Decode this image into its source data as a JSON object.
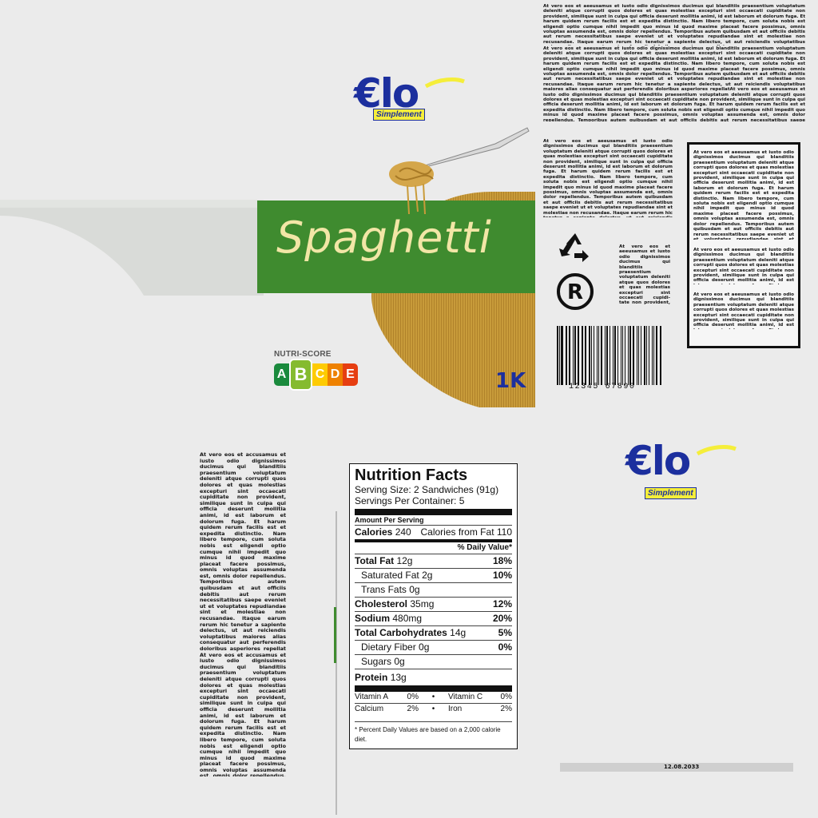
{
  "brand": {
    "name": "€lo",
    "tagline": "Simplement"
  },
  "product": {
    "name": "Spaghetti",
    "weight": "1K"
  },
  "nutriscore": {
    "label": "NUTRI-SCORE",
    "grades": [
      "A",
      "B",
      "C",
      "D",
      "E"
    ],
    "active": "B",
    "colors": {
      "A": "#1a8a3d",
      "B": "#85bb2f",
      "C": "#fecb02",
      "D": "#ee8100",
      "E": "#e63e11"
    }
  },
  "barcode": {
    "number": "12345 67890"
  },
  "date": "12.08.2033",
  "lorem": {
    "top_right": "At vero eos et aeeusamus et iusto odio dignissimos ducimus qui blanditiis praesentium voluptatum deleniti atque corrupti quos dolores et quas molestias excepturi sint occaecati cupiditate non provident, similique sunt in culpa qui officia deserunt mollitia animi, id est laborum et dolorum fuga. Et harum quidem rerum facilis est et expedita distinctio. Nam libero tempore, cum soluta nobis est eligendi optio cumque nihil impedit quo minus id quod maxime placeat facere possimus, omnis voluptas assumenda est, omnis dolor repellendus. Temporibus autem quibusdam et aut officiis debitis aut rerum necessitatibus saepe eveniet ut et voluptates repudiandae sint et molestiae non recusandae. Itaque earum rerum hic tenetur a sapiente delectus, ut aut reiciendis voluptatibus maiores alias consequatur aut perferendis doloribus asperiores repellat",
    "top_right_2": "At vero eos et aeeusamus et iusto odio dignissimos ducimus qui blanditiis praesentium voluptatum deleniti atque corrupti quos dolores et quas molestias excepturi sint occaecati cupiditate non provident, similique sunt in culpa qui officia deserunt mollitia animi, id est laborum et dolorum fuga. Et harum quidem rerum facilis est et expedita distinctio. Nam libero tempore, cum soluta nobis est eligendi optio cumque nihil impedit quo minus id quod maxime placeat facere possimus, omnis voluptas assumenda est, omnis dolor repellendus. Temporibus autem quibusdam et aut officiis debitis aut rerum necessitatibus saepe eveniet ut et voluptates repudiandae sint et molestiae non recusandae. Itaque earum rerum hic tenetur a sapiente delectus, ut aut reiciendis voluptatibus maiores alias consequatur aut perferendis doloribus asperiores repellatAt vero eos et aeeusamus et iusto odio dignissimos ducimus qui blanditiis praesentium voluptatum deleniti atque corrupti quos dolores et quas molestias excepturi sint occaecati cupiditate non provident, similique sunt in culpa qui officia deserunt mollitia animi, id est laborum et dolorum fuga. Et harum quidem rerum facilis est et expedita distinctio. Nam libero tempore, cum soluta nobis est eligendi optio cumque nihil impedit quo minus id quod maxime placeat facere possimus, omnis voluptas assumenda est, omnis dolor repellendus. Temporibus autem quibusdam et aut officiis debitis aut rerum necessitatibus saepe eveniet ut et voluptates repudiandae sint et molestiae non recusandae. Itaque earum rerum hic tenetur a sapiente delectus, ut aut reiciendis voluptatibus maiores alias consequatur aut perferendis doloribus asperiores repellat",
    "mid_right": "At vero eos et aeeusamus et iusto odio dignissimos ducimus qui blanditiis praesentium voluptatum deleniti atque corrupti quos dolores et quas molestias excepturi sint occaecati cupiditate non provident, similique sunt in culpa qui officia deserunt mollitia animi, id est laborum et dolorum fuga. Et harum quidem rerum facilis est et expedita distinctio. Nam libero tempore, cum soluta nobis est eligendi optio cumque nihil impedit quo minus id quod maxime placeat facere possimus, omnis voluptas assumenda est, omnis dolor repellendus. Temporibus autem quibusdam et aut officiis debitis aut rerum necessitatibus saepe eveniet ut et voluptates repudiandae sint et molestiae non recusandae. Itaque earum rerum hic tenetur a sapiente delectus, ut aut reiciendis voluptatibus maiores alias consequatur aut perferendis doloribus asperiores repellat",
    "small_block": "At vero eos et aeeusamus et iusto odio dignissimos ducimus qui blanditiis praesentium voluptatum deleniti atque quos dolores et quas molestias excepturi sint occaecati cupidi-tate non provident, similique sunt in",
    "boxed_1": "At vero eos et aeeusamus et iusto odio dignissimos ducimus qui blanditiis praesentium voluptatum deleniti atque corrupti quos dolores et quas molestias excepturi sint occaecati cupiditate non provident, similique sunt in culpa qui officia deserunt mollitia animi, id est laborum et dolorum fuga. Et harum quidem rerum facilis est et expedita distinctio. Nam libero tempore, cum soluta nobis est eligendi optio cumque nihil impedit quo minus id quod maxime placeat facere possimus, omnis voluptas assumenda est, omnis dolor repellendus. Temporibus autem quibusdam et aut officiis debitis aut rerum necessitatibus saepe eveniet ut et voluptates repudiandae sint et molestiae non recusandae. Itaque earum rerum hic tenetur a sapiente delectus, ut aut reiciendis voluptatibus maiores alias consequatur aut perferendis doloribus asperiores repellat",
    "boxed_2": "At vero eos et aeeusamus et iusto odio dignissimos ducimus qui blanditiis praesentium voluptatum deleniti atque corrupti quos dolores et quas molestias excepturi sint occaecati cupiditate non provident, similique sunt in culpa qui officia deserunt mollitia animi, id est laborum et dolorum fuga. Et harum quidem rerum facilis est et expedita distinctio. Nam libero",
    "boxed_3": "At vero eos et aeeusamus et iusto odio dignissimos ducimus qui blanditiis praesentium voluptatum deleniti atque corrupti quos dolores et quas molestias excepturi sint occaecati cupiditate non provident, similique sunt in culpa qui officia deserunt mollitia animi, id est laborum et dolorum fuga. Et harum quidem rerum facilis est et expedita distinctio. Nam libero",
    "left_column": "At vero eos et accusamus et iusto odio dignissimos ducimus qui blanditiis praesentium voluptatum deleniti atque corrupti quos dolores et quas molestias excepturi sint occaecati cupiditate non provident, similique sunt in culpa qui officia deserunt mollitia animi, id est laborum et dolorum fuga. Et harum quidem rerum facilis est et expedita distinctio. Nam libero tempore, cum soluta nobis est eligendi optio cumque nihil impedit quo minus id quod maxime placeat facere possimus, omnis voluptas assumenda est, omnis dolor repellendus. Temporibus autem quibusdam et aut officiis debitis aut rerum necessitatibus saepe eveniet ut et voluptates repudiandae sint et molestiae non recusandae. Itaque earum rerum hic tenetur a sapiente delectus, ut aut reiciendis voluptatibus maiores alias consequatur aut perferendis doloribus asperiores repellat At vero eos et accusamus et iusto odio dignissimos ducimus qui blanditiis praesentium voluptatum deleniti atque corrupti quos dolores et quas molestias excepturi sint occaecati cupiditate non provident, similique sunt in culpa qui officia deserunt mollitia animi, id est laborum et dolorum fuga. Et harum quidem rerum facilis est et expedita distinctio. Nam libero tempore, cum soluta nobis est eligendi optio cumque nihil impedit quo minus id quod maxime placeat facere possimus, omnis voluptas assumenda est, omnis dolor repellendus. Temporibus autem quibusdam et aut officiis debitis aut rerum necessitatibus saepe eveniet ut et voluptates repudiandae sint et molestiae non recusandae. Itaque earum rerum hic tenetur a sapiente delectus, ut aut reiciendis voluptatibus maiores alias consequatur aut perferendis doloribus asperiores repellat"
  },
  "nutrition": {
    "title": "Nutrition Facts",
    "serving_size": "Serving Size: 2 Sandwiches (91g)",
    "servings_per": "Servings Per Container: 5",
    "amount_per": "Amount Per Serving",
    "calories_label": "Calories",
    "calories_value": "240",
    "calories_fat": "Calories from Fat 110",
    "daily_value": "% Daily Value*",
    "rows": [
      {
        "label": "Total Fat",
        "value": "12g",
        "pct": "18%",
        "bold": true,
        "indent": false
      },
      {
        "label": "Saturated Fat",
        "value": "2g",
        "pct": "10%",
        "bold": false,
        "indent": true
      },
      {
        "label": "Trans Fats",
        "value": "0g",
        "pct": "",
        "bold": false,
        "indent": true
      },
      {
        "label": "Cholesterol",
        "value": "35mg",
        "pct": "12%",
        "bold": true,
        "indent": false
      },
      {
        "label": "Sodium",
        "value": "480mg",
        "pct": "20%",
        "bold": true,
        "indent": false
      },
      {
        "label": "Total Carbohydrates",
        "value": "14g",
        "pct": "5%",
        "bold": true,
        "indent": false
      },
      {
        "label": "Dietary Fiber",
        "value": "0g",
        "pct": "0%",
        "bold": false,
        "indent": true
      },
      {
        "label": "Sugars",
        "value": "0g",
        "pct": "",
        "bold": false,
        "indent": true
      },
      {
        "label": "Protein",
        "value": "13g",
        "pct": "",
        "bold": true,
        "indent": false
      }
    ],
    "vitamins": [
      {
        "a": "Vitamin A",
        "av": "0%",
        "b": "Vitamin C",
        "bv": "0%"
      },
      {
        "a": "Calcium",
        "av": "2%",
        "b": "Iron",
        "bv": "2%"
      }
    ],
    "footnote": "* Percent Daily Values are based on a 2,000 calorie diet."
  }
}
